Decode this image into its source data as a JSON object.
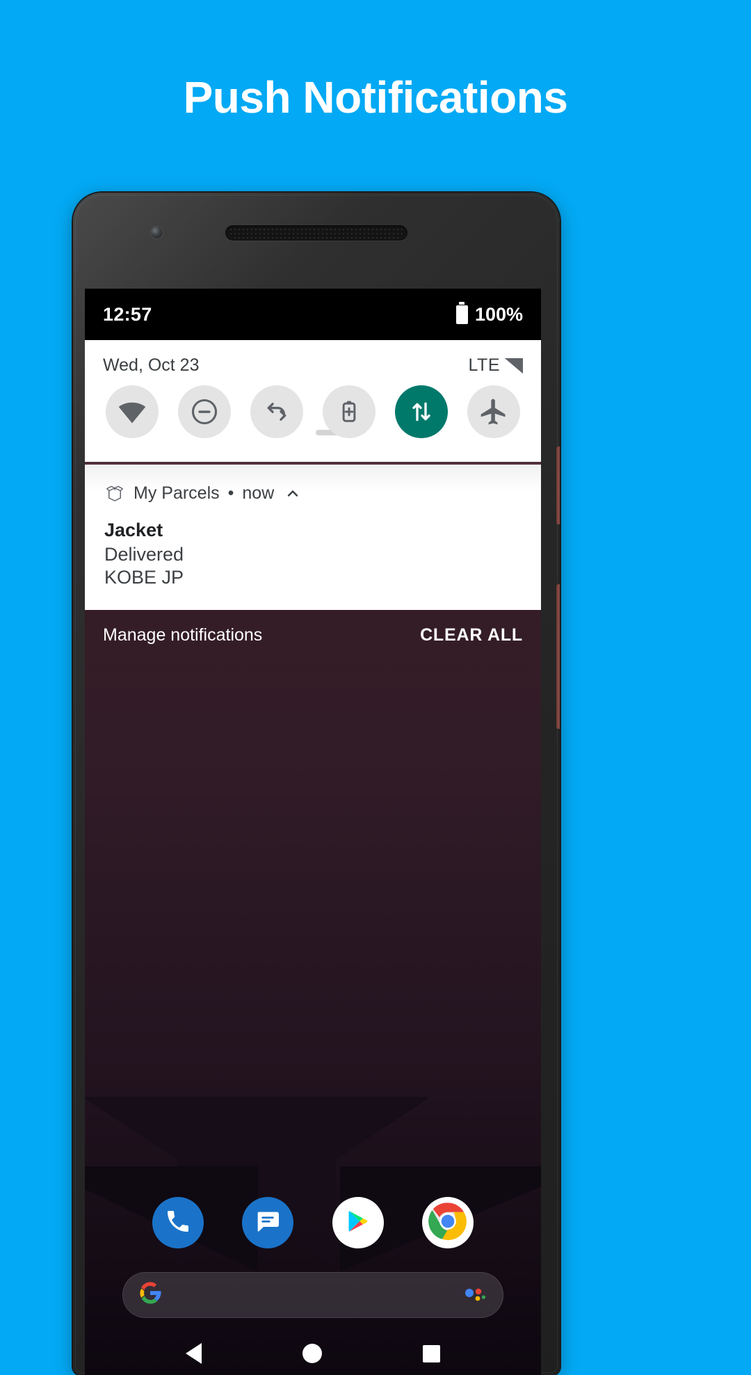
{
  "page": {
    "headline": "Push Notifications",
    "background_color": "#03A9F4"
  },
  "status_bar": {
    "time": "12:57",
    "battery_percent": "100%",
    "battery_icon": "battery-full-icon"
  },
  "quick_settings": {
    "date": "Wed, Oct 23",
    "network_label": "LTE",
    "signal_icon": "signal-bars-icon",
    "tiles": [
      {
        "name": "wifi-tile",
        "icon": "wifi-icon",
        "active": false
      },
      {
        "name": "do-not-disturb-tile",
        "icon": "do-not-disturb-icon",
        "active": false
      },
      {
        "name": "auto-rotate-tile",
        "icon": "auto-rotate-icon",
        "active": false
      },
      {
        "name": "battery-saver-tile",
        "icon": "battery-saver-icon",
        "active": false
      },
      {
        "name": "mobile-data-tile",
        "icon": "data-transfer-icon",
        "active": true
      },
      {
        "name": "airplane-mode-tile",
        "icon": "airplane-icon",
        "active": false
      }
    ],
    "active_color": "#00796B"
  },
  "notification": {
    "app_icon": "parcel-box-icon",
    "app_name": "My Parcels",
    "separator": "•",
    "time": "now",
    "expand_icon": "chevron-up-icon",
    "title": "Jacket",
    "status": "Delivered",
    "location": "KOBE JP"
  },
  "shade_actions": {
    "manage_label": "Manage notifications",
    "clear_all_label": "CLEAR ALL"
  },
  "dock": {
    "items": [
      {
        "name": "dock-phone",
        "icon": "phone-icon",
        "label": "Phone"
      },
      {
        "name": "dock-messages",
        "icon": "messages-icon",
        "label": "Messages"
      },
      {
        "name": "dock-play-store",
        "icon": "play-store-icon",
        "label": "Play Store"
      },
      {
        "name": "dock-chrome",
        "icon": "chrome-icon",
        "label": "Chrome"
      }
    ]
  },
  "search": {
    "logo": "G",
    "assistant_icon": "assistant-dots-icon"
  },
  "nav_bar": {
    "back": "back-triangle-icon",
    "home": "home-circle-icon",
    "recents": "recents-square-icon"
  }
}
